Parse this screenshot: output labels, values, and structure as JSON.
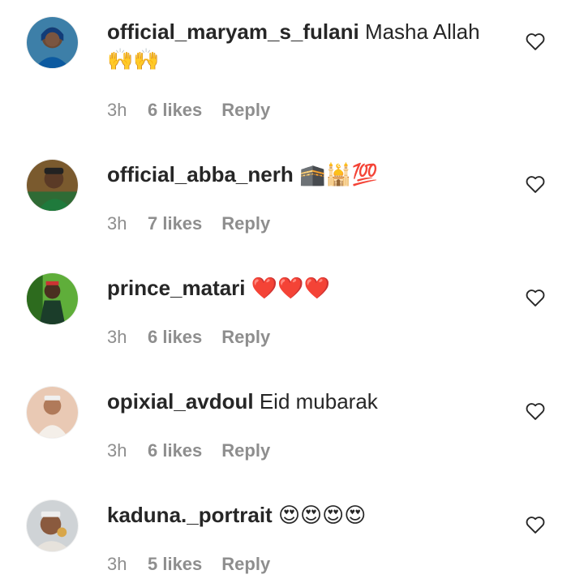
{
  "colors": {
    "text": "#262626",
    "muted": "#8e8e8e",
    "heart_emoji": "#e0245e"
  },
  "comments": [
    {
      "username": "official_maryam_s_fulani",
      "text": "Masha Allah",
      "emoji": "🙌🙌",
      "time": "3h",
      "likes": "6 likes",
      "reply": "Reply",
      "icon": "heart-outline-icon"
    },
    {
      "username": "official_abba_nerh",
      "text": "",
      "emoji": "🕋🕌💯",
      "time": "3h",
      "likes": "7 likes",
      "reply": "Reply",
      "icon": "heart-outline-icon"
    },
    {
      "username": "prince_matari",
      "text": "",
      "emoji": "❤️❤️❤️",
      "time": "3h",
      "likes": "6 likes",
      "reply": "Reply",
      "icon": "heart-outline-icon"
    },
    {
      "username": "opixial_avdoul",
      "text": "Eid mubarak",
      "emoji": "",
      "time": "3h",
      "likes": "6 likes",
      "reply": "Reply",
      "icon": "heart-outline-icon"
    },
    {
      "username": "kaduna._portrait",
      "text": "",
      "emoji": "😍😍😍😍",
      "time": "3h",
      "likes": "5 likes",
      "reply": "Reply",
      "icon": "heart-outline-icon"
    }
  ]
}
